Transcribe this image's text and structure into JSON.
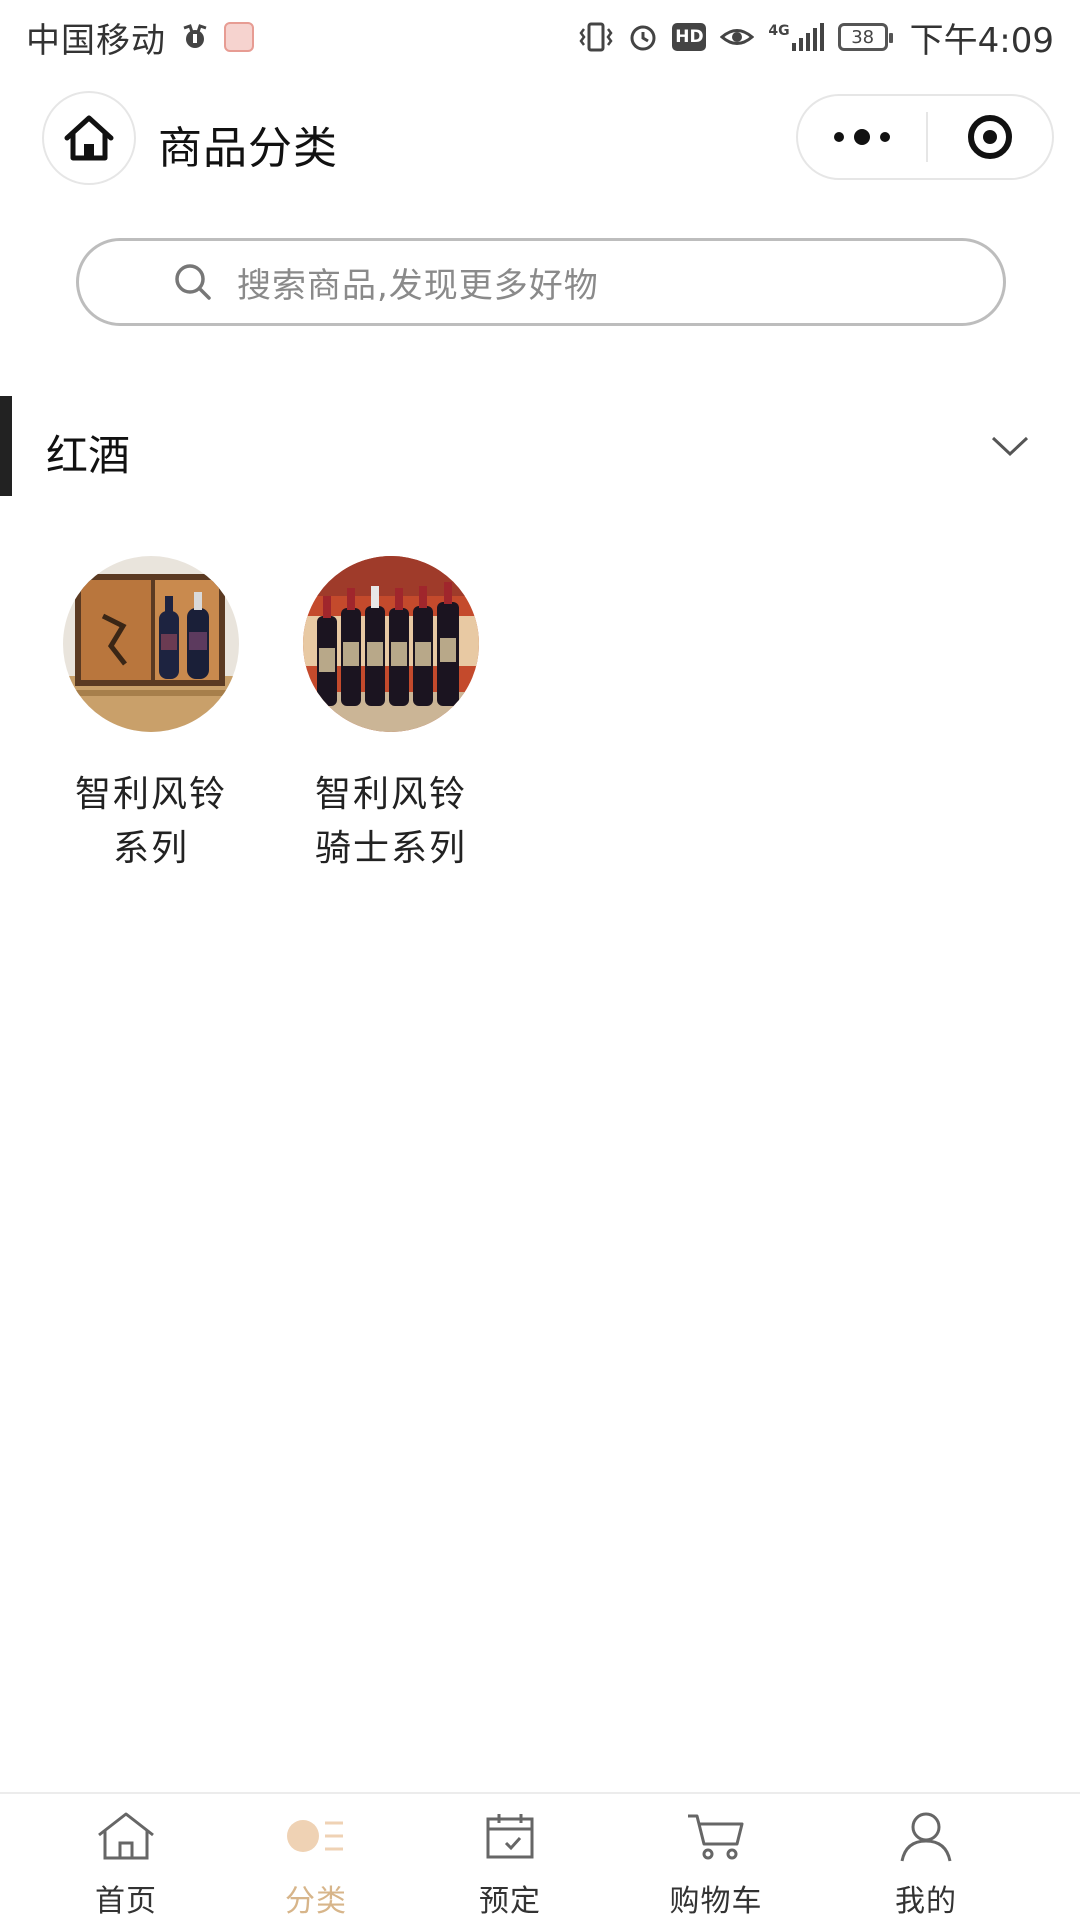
{
  "status_bar": {
    "carrier": "中国移动",
    "network": "4G",
    "battery": "38",
    "time": "下午4:09",
    "hd_label": "HD"
  },
  "title_bar": {
    "title": "商品分类"
  },
  "search": {
    "placeholder": "搜索商品,发现更多好物"
  },
  "category": {
    "title": "红酒",
    "expanded": false
  },
  "products": [
    {
      "name_line1": "智利风铃",
      "name_line2": "系列"
    },
    {
      "name_line1": "智利风铃",
      "name_line2": "骑士系列"
    }
  ],
  "tab_bar": {
    "tabs": [
      {
        "label": "首页",
        "icon": "home-icon",
        "active": false
      },
      {
        "label": "分类",
        "icon": "category-icon",
        "active": true
      },
      {
        "label": "预定",
        "icon": "calendar-icon",
        "active": false
      },
      {
        "label": "购物车",
        "icon": "cart-icon",
        "active": false
      },
      {
        "label": "我的",
        "icon": "user-icon",
        "active": false
      }
    ]
  },
  "colors": {
    "accent": "#d7b58a",
    "text": "#222222",
    "border": "#bdbdbd",
    "category_marker": "#222222"
  }
}
